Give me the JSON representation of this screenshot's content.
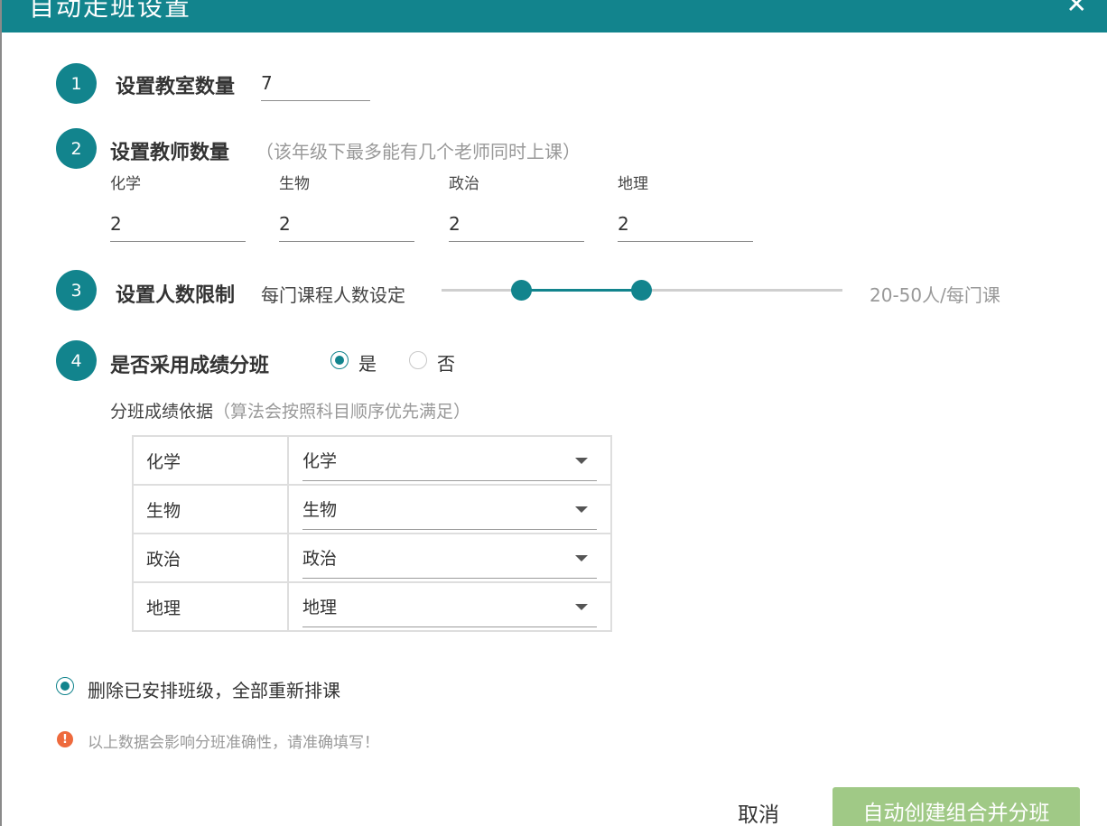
{
  "dialog": {
    "title": "自动走班设置",
    "close_glyph": "✕"
  },
  "steps": [
    {
      "number": "1",
      "title": "设置教室数量",
      "value": "7"
    },
    {
      "number": "2",
      "title": "设置教师数量",
      "hint": "（该年级下最多能有几个老师同时上课）",
      "subjects": [
        {
          "label": "化学",
          "value": "2"
        },
        {
          "label": "生物",
          "value": "2"
        },
        {
          "label": "政治",
          "value": "2"
        },
        {
          "label": "地理",
          "value": "2"
        }
      ]
    },
    {
      "number": "3",
      "title": "设置人数限制",
      "sublabel": "每门课程人数设定",
      "range_text": "20-50人/每门课",
      "range_min": 20,
      "range_max": 50
    },
    {
      "number": "4",
      "title": "是否采用成绩分班",
      "options": [
        {
          "label": "是",
          "checked": true
        },
        {
          "label": "否",
          "checked": false
        }
      ]
    }
  ],
  "basis": {
    "title": "分班成绩依据",
    "hint": "（算法会按照科目顺序优先满足）",
    "rows": [
      {
        "subject": "化学",
        "selected": "化学"
      },
      {
        "subject": "生物",
        "selected": "生物"
      },
      {
        "subject": "政治",
        "selected": "政治"
      },
      {
        "subject": "地理",
        "selected": "地理"
      }
    ]
  },
  "reset_option": {
    "label": "删除已安排班级，全部重新排课",
    "checked": true
  },
  "warning": {
    "glyph": "!",
    "text": "以上数据会影响分班准确性，请准确填写！"
  },
  "footer": {
    "cancel_label": "取消",
    "submit_label": "自动创建组合并分班"
  },
  "colors": {
    "accent": "#12848d",
    "submit": "#a0c986",
    "warning": "#ee6a3d"
  }
}
